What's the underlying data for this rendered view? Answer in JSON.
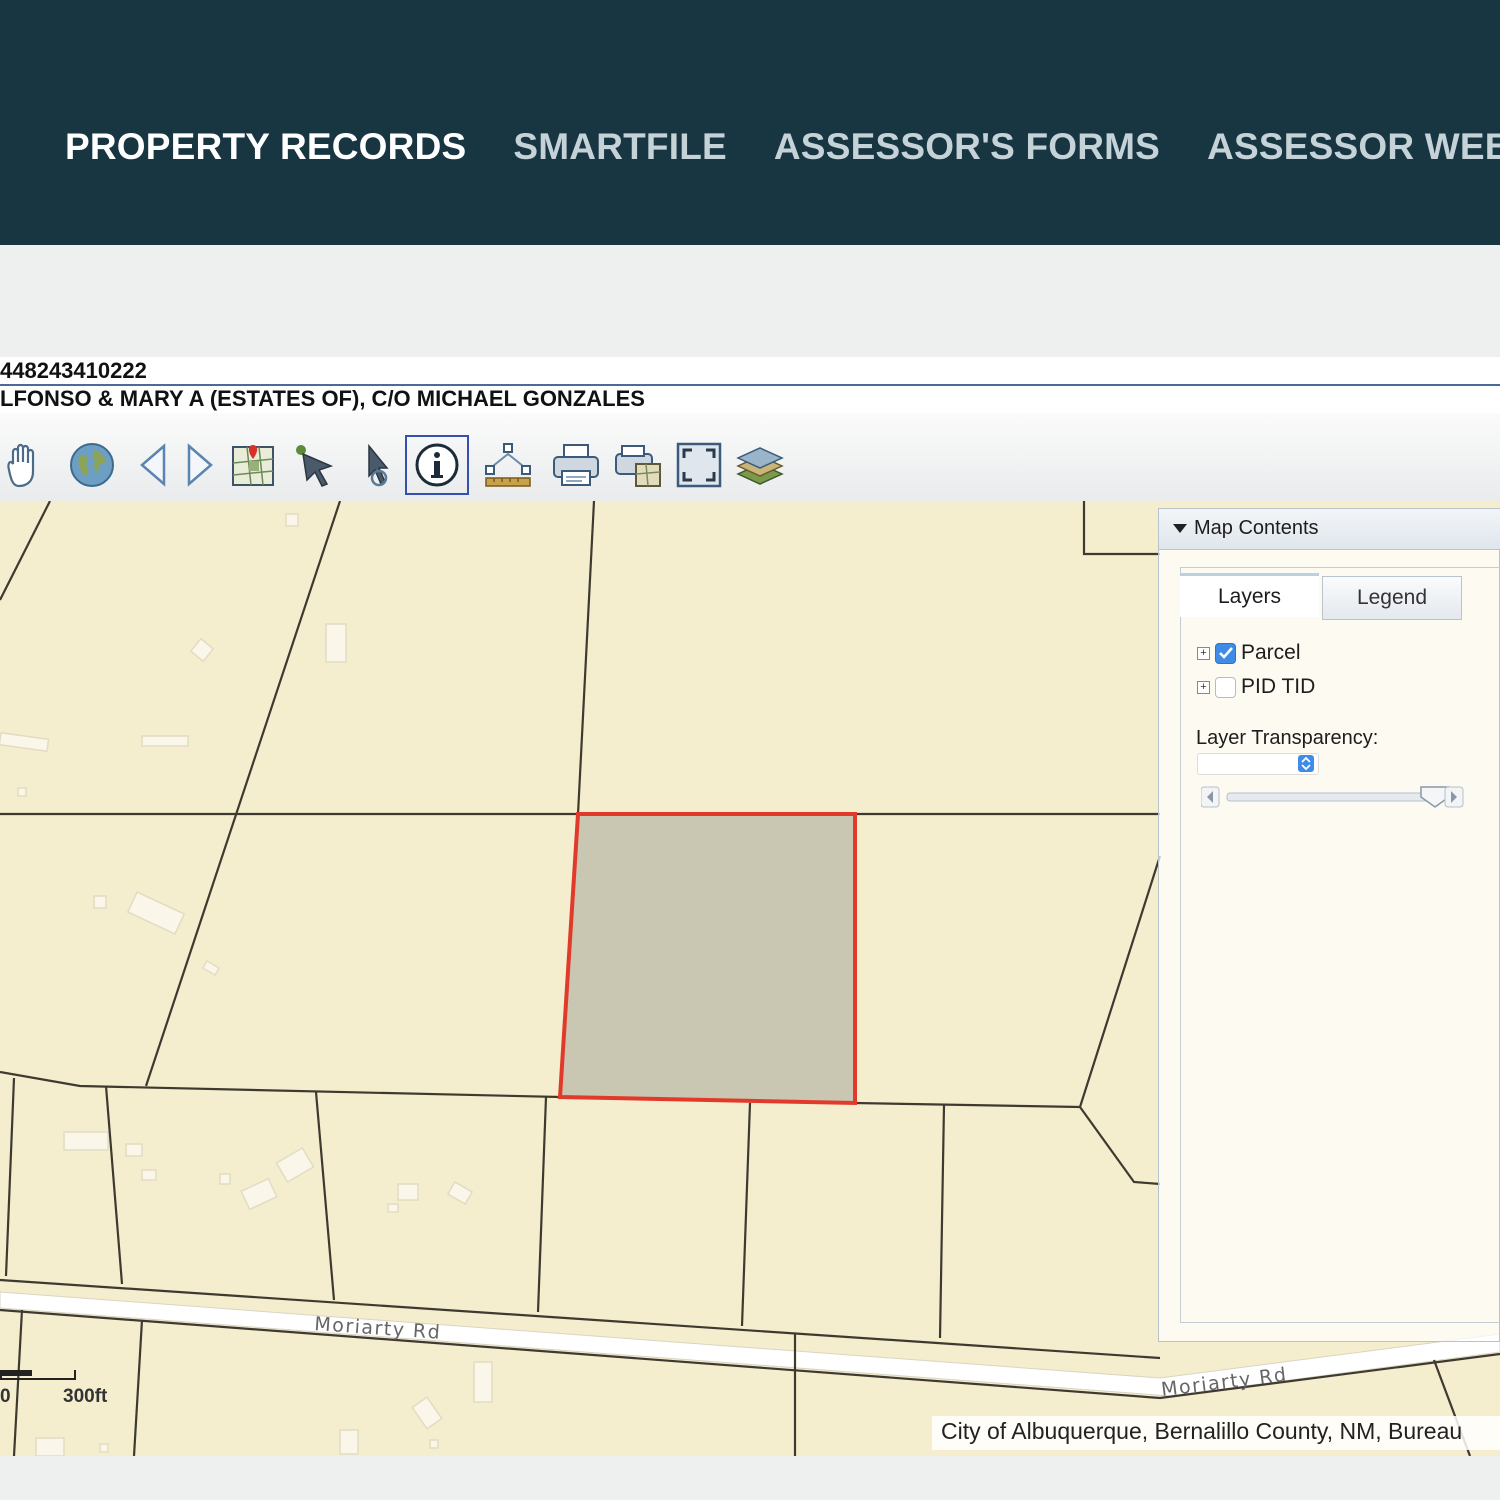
{
  "nav": {
    "items": [
      {
        "label": "PROPERTY RECORDS"
      },
      {
        "label": "SMARTFILE"
      },
      {
        "label": "ASSESSOR'S FORMS"
      },
      {
        "label": "ASSESSOR WEBSI"
      }
    ]
  },
  "parcel": {
    "id": "448243410222",
    "owner": "LFONSO & MARY A (ESTATES OF), C/O MICHAEL GONZALES"
  },
  "toolbar": {
    "tools": [
      "pan-hand-icon",
      "globe-icon",
      "back-arrow-icon",
      "forward-arrow-icon",
      "map-marker-icon",
      "select-arrow-icon",
      "select-identify-icon",
      "info-icon",
      "measure-icon",
      "print-icon",
      "print-map-icon",
      "full-extent-icon",
      "layers-icon"
    ],
    "active_tool": "info-icon"
  },
  "map": {
    "road_label_1": "Moriarty Rd",
    "road_label_2": "Moriarty Rd",
    "scale_zero": "0",
    "scale_label": "300ft",
    "attribution": "City of Albuquerque, Bernalillo County, NM, Bureau",
    "selected_parcel_color": "#e23a2a"
  },
  "map_contents": {
    "title": "Map Contents",
    "tabs": [
      {
        "label": "Layers"
      },
      {
        "label": "Legend"
      }
    ],
    "layers": [
      {
        "name": "Parcel",
        "checked": true
      },
      {
        "name": "PID TID",
        "checked": false
      }
    ],
    "transparency_label": "Layer Transparency:"
  },
  "colors": {
    "header_bg": "#183542",
    "map_bg": "#f4eece",
    "accent": "#3e8ce8"
  }
}
